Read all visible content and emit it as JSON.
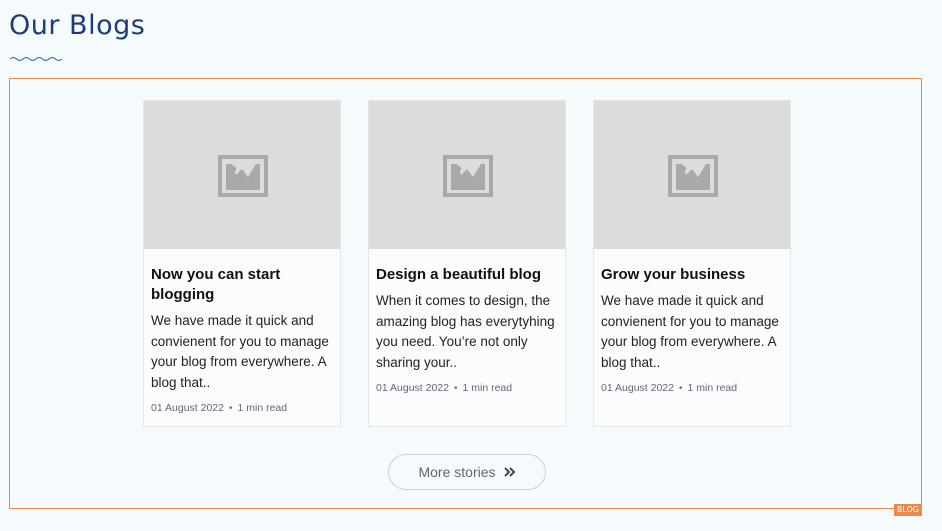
{
  "section": {
    "title": "Our Blogs",
    "tag": "BLOG"
  },
  "cards": [
    {
      "title": "Now you can start blogging",
      "excerpt": "We have made it quick and convienent for you to manage your blog from everywhere. A blog that..",
      "date": "01 August 2022",
      "separator": "•",
      "read_time": "1 min read",
      "image_icon": "image-placeholder-icon"
    },
    {
      "title": "Design a beautiful blog",
      "excerpt": "When it comes to design, the amazing blog has everytyhing you need. You’re not only sharing your..",
      "date": "01 August 2022",
      "separator": "•",
      "read_time": "1 min read",
      "image_icon": "image-placeholder-icon"
    },
    {
      "title": "Grow your business",
      "excerpt": "We have made it quick and convienent for you to manage your blog from everywhere. A blog that..",
      "date": "01 August 2022",
      "separator": "•",
      "read_time": "1 min read",
      "image_icon": "image-placeholder-icon"
    }
  ],
  "more_button": {
    "label": "More stories",
    "icon": "double-chevron-right-icon"
  },
  "colors": {
    "title": "#1f3c7a",
    "frame": "#ea8a4a",
    "background": "#f5fafd",
    "placeholder": "#dcdcdc"
  }
}
